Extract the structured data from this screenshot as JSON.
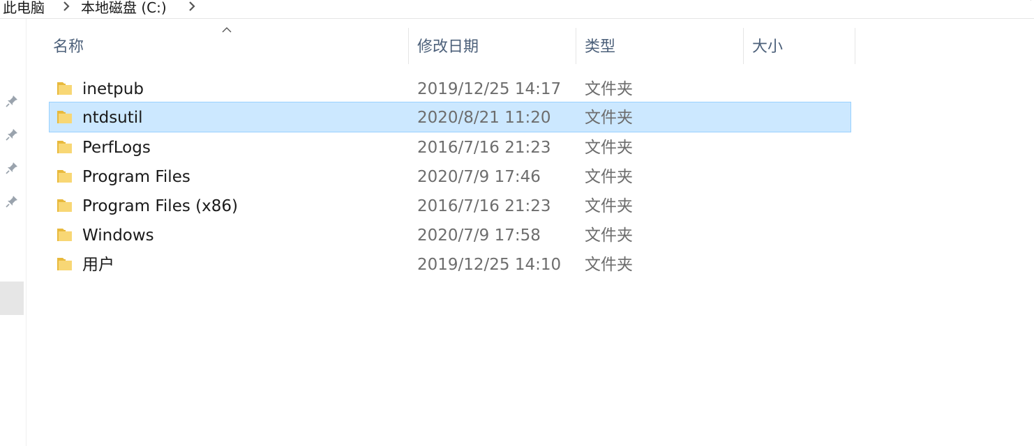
{
  "breadcrumb": {
    "items": [
      "此电脑",
      "本地磁盘 (C:)"
    ]
  },
  "columns": {
    "name": "名称",
    "date": "修改日期",
    "type": "类型",
    "size": "大小"
  },
  "files": [
    {
      "name": "inetpub",
      "date": "2019/12/25 14:17",
      "type": "文件夹",
      "size": "",
      "selected": false
    },
    {
      "name": "ntdsutil",
      "date": "2020/8/21 11:20",
      "type": "文件夹",
      "size": "",
      "selected": true
    },
    {
      "name": "PerfLogs",
      "date": "2016/7/16 21:23",
      "type": "文件夹",
      "size": "",
      "selected": false
    },
    {
      "name": "Program Files",
      "date": "2020/7/9 17:46",
      "type": "文件夹",
      "size": "",
      "selected": false
    },
    {
      "name": "Program Files (x86)",
      "date": "2016/7/16 21:23",
      "type": "文件夹",
      "size": "",
      "selected": false
    },
    {
      "name": "Windows",
      "date": "2020/7/9 17:58",
      "type": "文件夹",
      "size": "",
      "selected": false
    },
    {
      "name": "用户",
      "date": "2019/12/25 14:10",
      "type": "文件夹",
      "size": "",
      "selected": false
    }
  ],
  "colors": {
    "selection": "#cce8ff",
    "selection_border": "#99d1ff",
    "header_text": "#4c607a",
    "folder": "#f8d775"
  },
  "icons": {
    "folder": "folder-icon",
    "pin": "pin-icon",
    "chevron": "chevron-right-icon",
    "sort": "sort-ascending-icon"
  }
}
